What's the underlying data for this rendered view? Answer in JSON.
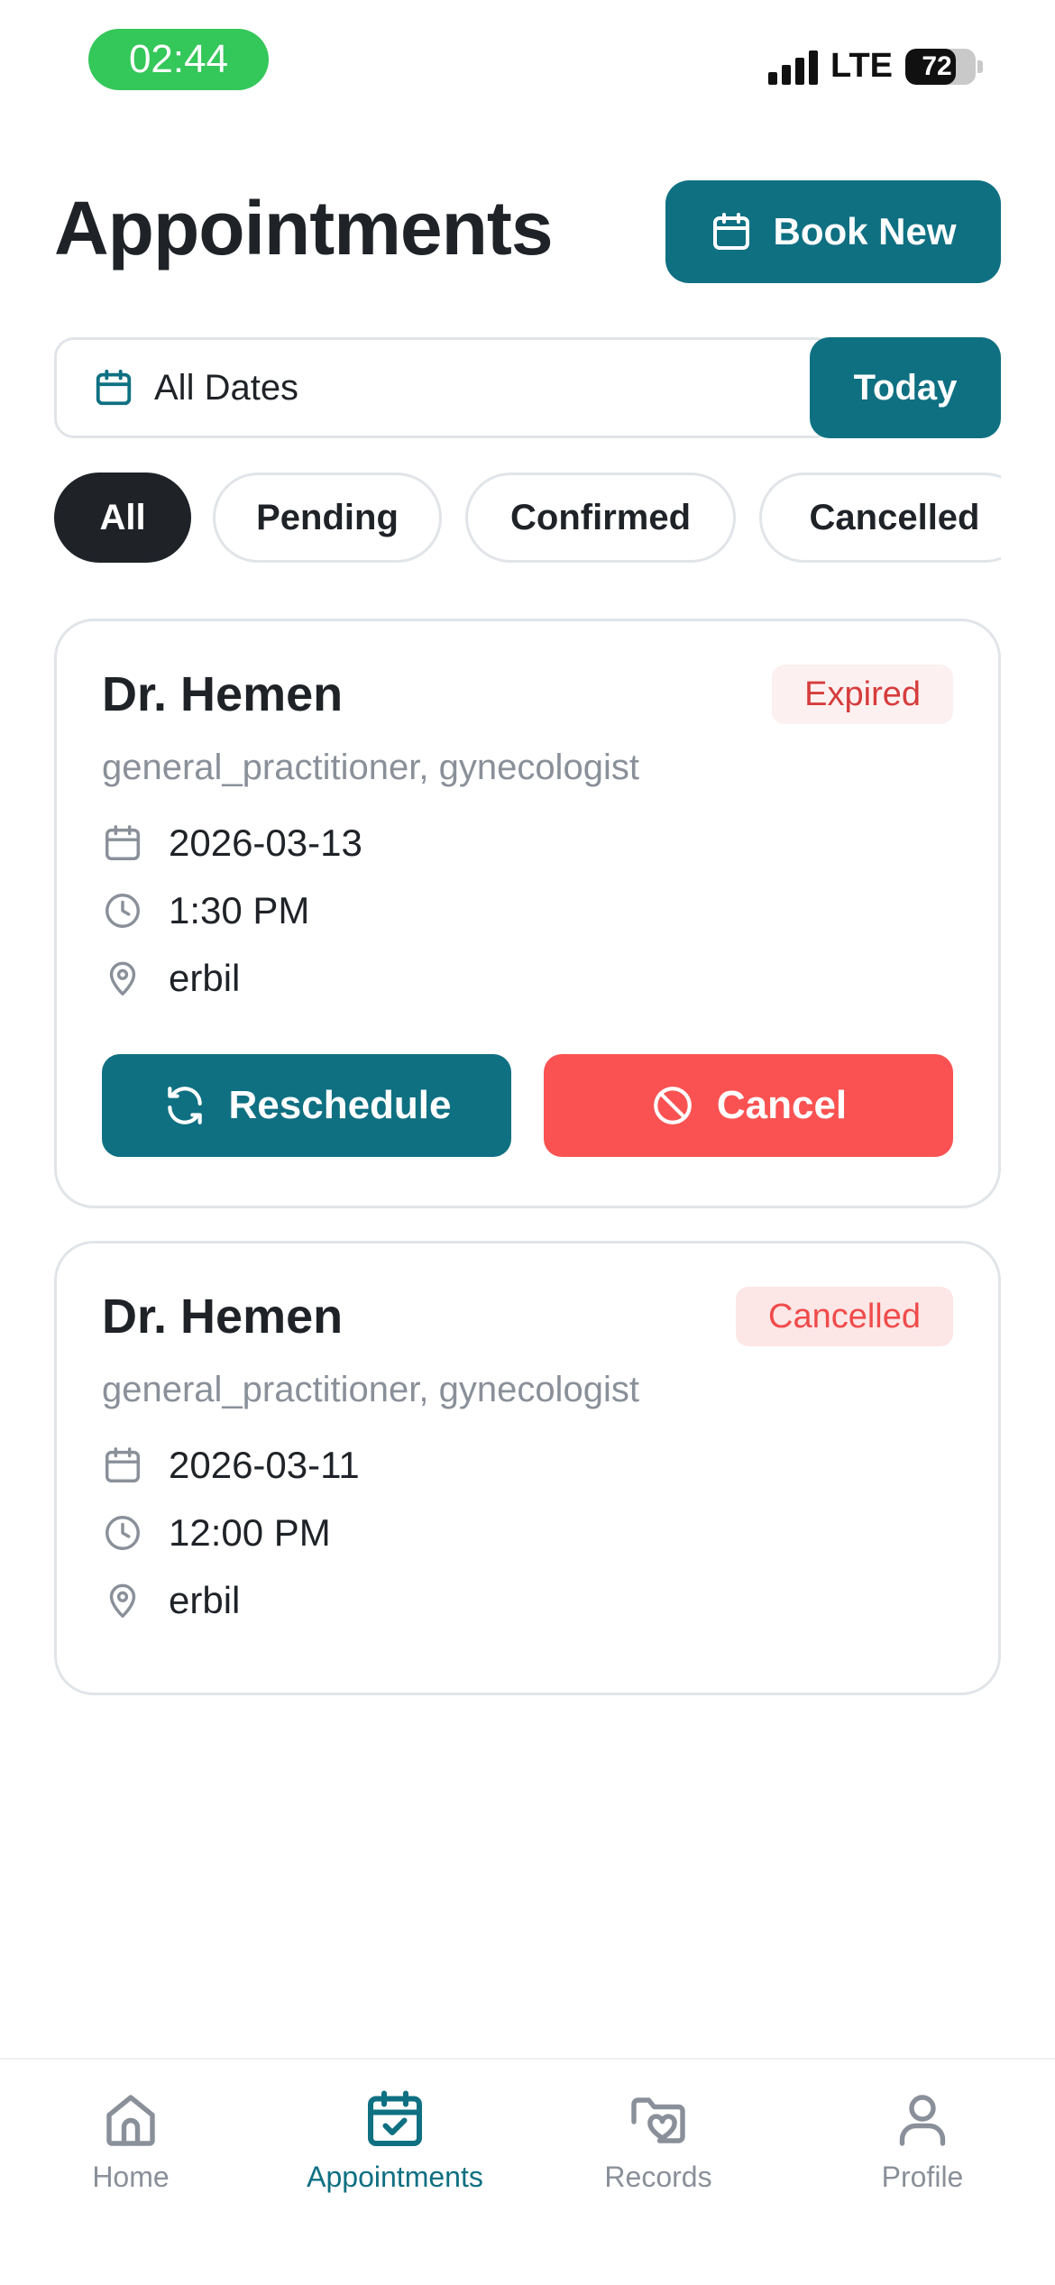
{
  "status_bar": {
    "time": "02:44",
    "network": "LTE",
    "battery": 72
  },
  "header": {
    "title": "Appointments",
    "book_new_label": "Book New"
  },
  "filters": {
    "date_label": "All Dates",
    "today_label": "Today",
    "chips": [
      {
        "label": "All",
        "active": true
      },
      {
        "label": "Pending",
        "active": false
      },
      {
        "label": "Confirmed",
        "active": false
      },
      {
        "label": "Cancelled",
        "active": false
      }
    ]
  },
  "appointments": [
    {
      "doctor": "Dr. Hemen",
      "specialty": "general_practitioner, gynecologist",
      "status": "Expired",
      "date": "2026-03-13",
      "time": "1:30 PM",
      "location": "erbil",
      "actions": {
        "reschedule": "Reschedule",
        "cancel": "Cancel"
      }
    },
    {
      "doctor": "Dr. Hemen",
      "specialty": "general_practitioner, gynecologist",
      "status": "Cancelled",
      "date": "2026-03-11",
      "time": "12:00 PM",
      "location": "erbil"
    }
  ],
  "tabbar": [
    {
      "label": "Home",
      "icon": "home-icon",
      "active": false
    },
    {
      "label": "Appointments",
      "icon": "calendar-check-icon",
      "active": true
    },
    {
      "label": "Records",
      "icon": "folder-heart-icon",
      "active": false
    },
    {
      "label": "Profile",
      "icon": "user-icon",
      "active": false
    }
  ],
  "colors": {
    "primary": "#0f7082",
    "danger": "#fa5252",
    "expired_text": "#d63c3c",
    "expired_bg": "#fdf0f0",
    "cancelled_text": "#f04b4b",
    "cancelled_bg": "#fde6e6",
    "chip_active": "#1f2328"
  }
}
